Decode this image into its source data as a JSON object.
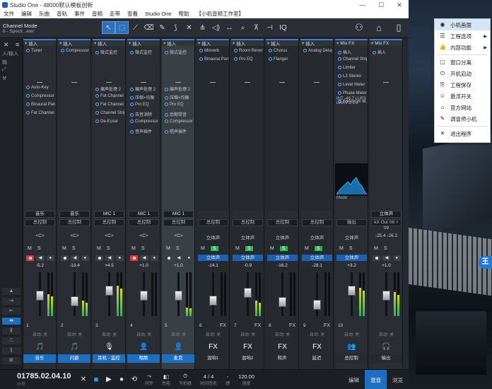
{
  "window": {
    "title": "Studio One - 48000默认模板创新",
    "controls": [
      "—",
      "☐",
      "✕"
    ]
  },
  "menubar": [
    "文件",
    "编辑",
    "乐曲",
    "音轨",
    "事件",
    "音频",
    "走带",
    "查看",
    "Studio One",
    "帮助",
    "【小机音频工作室】"
  ],
  "toolbar": {
    "mode_line1": "Channel Mode",
    "mode_line2": "6 - Spectr...eter",
    "iq_label": "IQ"
  },
  "left_strip": {
    "top_items": [
      "✕",
      "≡"
    ],
    "labels": [
      "入/输入",
      "输",
      "⤢",
      "⚒"
    ]
  },
  "strips": [
    {
      "insert": "插入",
      "plugins": [
        "Tuner"
      ],
      "plugins2": [
        "Auto-Key",
        "Compressor",
        "Binaural Pan",
        "Fat Channel"
      ],
      "name": "音乐",
      "bus": "总控制",
      "pan": "<C>",
      "volume": "-5.2",
      "num": "1",
      "label": "音乐",
      "rec": true,
      "fx": false,
      "icon": "🎵"
    },
    {
      "insert": "插入",
      "plugins": [
        "Compressor"
      ],
      "plugins2": [],
      "name": "音乐",
      "bus": "总控制",
      "pan": "<C>",
      "volume": "-13.4",
      "num": "2",
      "label": "闪避",
      "rec": false,
      "fx": false,
      "icon": "🎵"
    },
    {
      "insert": "插入",
      "plugins": [
        "微式监控"
      ],
      "plugins2": [
        "编声处理 2",
        "Fat Channel 2",
        "Fat Channel",
        "Channel Strip",
        "De-Esser"
      ],
      "name": "MIC 1",
      "bus": "总控制",
      "pan": "<C>",
      "volume": "+4.5",
      "num": "3",
      "label": "耳机 - 监控",
      "rec": false,
      "fx": false,
      "icon": "🎙"
    },
    {
      "insert": "插入",
      "plugins": [
        "微式监控"
      ],
      "plugins2": [
        "编声处理 2",
        "压缩+均衡",
        "Pro EQ",
        "去音消除",
        "Compressor",
        "音声插件"
      ],
      "name": "MIC 1",
      "bus": "总控制",
      "pan": "<C>",
      "volume": "+1.0",
      "num": "4",
      "label": "唱歌",
      "rec": true,
      "fx": false,
      "icon": "👤"
    },
    {
      "insert": "插入",
      "plugins": [
        "微式监控"
      ],
      "plugins2": [
        "编声处理 2",
        "压缩+均衡",
        "Pro EQ",
        "后期带音",
        "Compressor",
        "唱声插件"
      ],
      "name": "MIC 1",
      "bus": "总控制",
      "pan": "<C>",
      "volume": "+1.0",
      "num": "5",
      "label": "麦克",
      "rec": false,
      "fx": false,
      "icon": "👤",
      "selected": true
    },
    {
      "insert": "插入",
      "plugins": [
        "Mixverb",
        "Binaural Pan"
      ],
      "plugins2": [],
      "name": "",
      "bus": "总控制",
      "pan": "立体声",
      "volume": "-14.1",
      "num": "6",
      "label": "混响1",
      "rec": false,
      "fx": true,
      "icon": "FX"
    },
    {
      "insert": "插入",
      "plugins": [
        "Room Reverb",
        "Pro EQ"
      ],
      "plugins2": [],
      "name": "",
      "bus": "总控制",
      "pan": "立体声",
      "volume": "-0.9",
      "num": "7",
      "label": "混响2",
      "rec": false,
      "fx": true,
      "icon": "FX"
    },
    {
      "insert": "插入",
      "plugins": [
        "Chorus",
        "Flanger"
      ],
      "plugins2": [],
      "name": "",
      "bus": "总控制",
      "pan": "立体声",
      "volume": "-16.2",
      "num": "8",
      "label": "和声",
      "rec": false,
      "fx": true,
      "icon": "FX"
    },
    {
      "insert": "插入",
      "plugins": [
        "Analog Delay"
      ],
      "plugins2": [],
      "name": "",
      "bus": "总控制",
      "pan": "立体声",
      "volume": "-28.1",
      "num": "9",
      "label": "延迟",
      "rec": false,
      "fx": true,
      "icon": "FX"
    },
    {
      "insert": "Mix FX",
      "plugins": [
        "插入",
        "Channel Strip",
        "Limiter",
        "L2 Stereo",
        "Level Meter",
        "Phase Meter",
        "Spectrum M..."
      ],
      "plugins2": [],
      "name": "",
      "bus": "输出",
      "pan": "立体声",
      "volume": "+3.2",
      "num": "10",
      "label": "总控制",
      "rec": false,
      "fx": false,
      "icon": "👥",
      "main": true
    },
    {
      "insert": "Mix FX",
      "plugins": [
        "插入"
      ],
      "plugins2": [],
      "name": "立体声",
      "bus": "kX Out 08 + 09",
      "pan": "-25.4  -26.2",
      "volume": "+1.0",
      "num": "",
      "label": "输出",
      "rec": false,
      "fx": false,
      "icon": "🎧",
      "out": true
    }
  ],
  "main_meter": {
    "int_label": "INT",
    "int_value": "-49.7",
    "int_unit": "LUFS",
    "lra_label": "LRA",
    "lra_value": "7.2",
    "lra_unit": "LU",
    "mode_label": "Mode"
  },
  "strip_common": {
    "mute": "M",
    "solo": "S",
    "auto": "自动: 关"
  },
  "transport": {
    "time": "01785.02.04.10",
    "time_unit": "小节",
    "sync_label": "同步",
    "perf_label": "性能",
    "metronome_label": "节拍器",
    "signature": "4 / 4",
    "signature_label": "时间签名",
    "key_label": "键",
    "tempo": "120.00",
    "tempo_label": "速度",
    "tabs": [
      "编辑",
      "混音",
      "浏览"
    ],
    "active_tab": "混音"
  },
  "context_menu": {
    "items": [
      {
        "icon": "◉",
        "label": "小机画面",
        "sub": false,
        "hl": true
      },
      {
        "icon": "☰",
        "label": "工程选项",
        "sub": true
      },
      {
        "icon": "👍",
        "label": "内部功能",
        "sub": true
      },
      {
        "sep": true
      },
      {
        "icon": "▢",
        "label": "窗口分离",
        "sub": false
      },
      {
        "icon": "⏻",
        "label": "开机启动",
        "sub": false
      },
      {
        "icon": "⎘",
        "label": "工程保存",
        "sub": false
      },
      {
        "icon": "☺",
        "label": "悬浮开关",
        "sub": false
      },
      {
        "icon": "⌂",
        "label": "官方网站",
        "sub": false
      },
      {
        "icon": "✎",
        "label": "调音师小机",
        "sub": false
      },
      {
        "sep": true
      },
      {
        "icon": "✕",
        "label": "退出程序",
        "sub": false
      }
    ]
  },
  "wallpaper_badge": "王"
}
